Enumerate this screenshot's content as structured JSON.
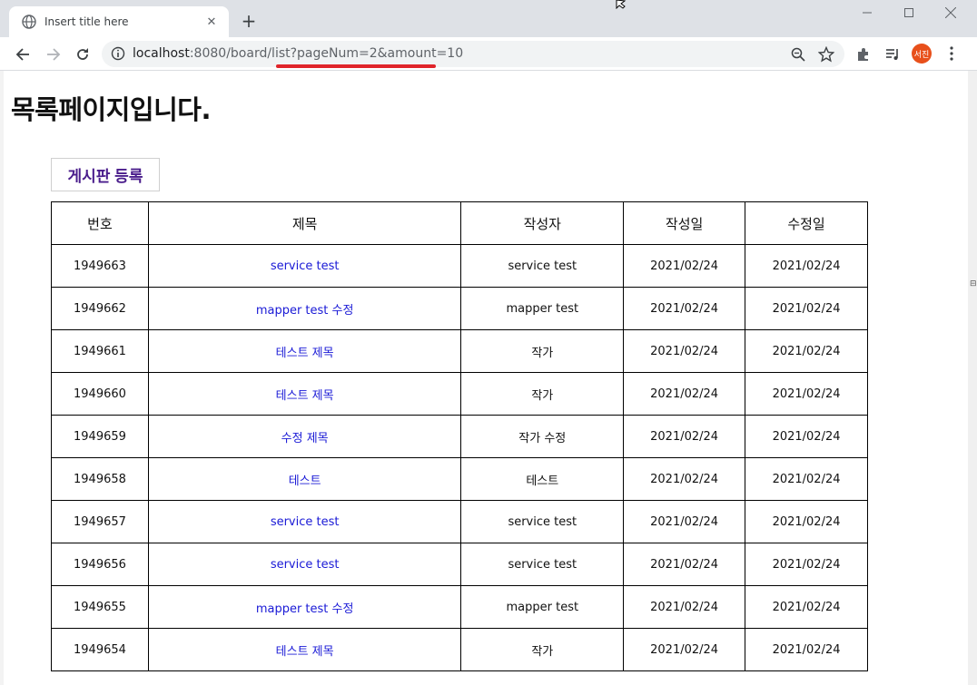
{
  "browser": {
    "tab_title": "Insert title here",
    "url_host": "localhost",
    "url_rest": ":8080/board/list?pageNum=2&amount=10",
    "profile_initials": "서진",
    "accent": "#e0242a"
  },
  "page": {
    "heading": "목록페이지입니다.",
    "register_button": "게시판 등록"
  },
  "table": {
    "headers": {
      "bno": "번호",
      "title": "제목",
      "writer": "작성자",
      "regdate": "작성일",
      "updatedate": "수정일"
    },
    "rows": [
      {
        "bno": "1949663",
        "title": "service test",
        "writer": "service test",
        "regdate": "2021/02/24",
        "updatedate": "2021/02/24"
      },
      {
        "bno": "1949662",
        "title": "mapper test 수정",
        "writer": "mapper test",
        "regdate": "2021/02/24",
        "updatedate": "2021/02/24"
      },
      {
        "bno": "1949661",
        "title": "테스트 제목",
        "writer": "작가",
        "regdate": "2021/02/24",
        "updatedate": "2021/02/24"
      },
      {
        "bno": "1949660",
        "title": "테스트 제목",
        "writer": "작가",
        "regdate": "2021/02/24",
        "updatedate": "2021/02/24"
      },
      {
        "bno": "1949659",
        "title": "수정 제목",
        "writer": "작가 수정",
        "regdate": "2021/02/24",
        "updatedate": "2021/02/24"
      },
      {
        "bno": "1949658",
        "title": "테스트",
        "writer": "테스트",
        "regdate": "2021/02/24",
        "updatedate": "2021/02/24"
      },
      {
        "bno": "1949657",
        "title": "service test",
        "writer": "service test",
        "regdate": "2021/02/24",
        "updatedate": "2021/02/24"
      },
      {
        "bno": "1949656",
        "title": "service test",
        "writer": "service test",
        "regdate": "2021/02/24",
        "updatedate": "2021/02/24"
      },
      {
        "bno": "1949655",
        "title": "mapper test 수정",
        "writer": "mapper test",
        "regdate": "2021/02/24",
        "updatedate": "2021/02/24"
      },
      {
        "bno": "1949654",
        "title": "테스트 제목",
        "writer": "작가",
        "regdate": "2021/02/24",
        "updatedate": "2021/02/24"
      }
    ]
  }
}
